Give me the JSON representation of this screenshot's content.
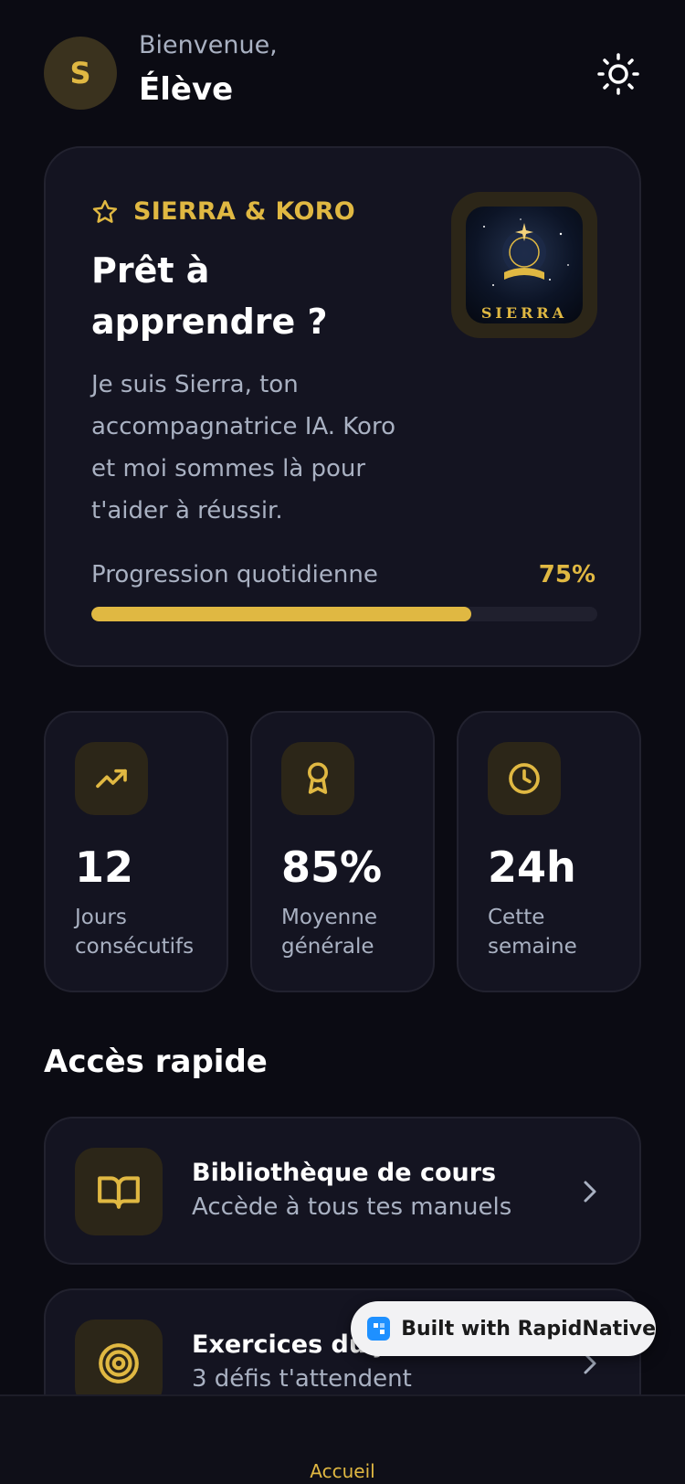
{
  "header": {
    "avatar_initial": "S",
    "greeting": "Bienvenue,",
    "user_name": "Élève",
    "theme_icon": "sun-icon"
  },
  "hero": {
    "brand": "SIERRA & KORO",
    "title": "Prêt à apprendre ?",
    "description": "Je suis Sierra, ton accompagnatrice IA. Koro et moi sommes là pour t'aider à réussir.",
    "logo_text": "SIERRA",
    "progress_label": "Progression quotidienne",
    "progress_text": "75%",
    "progress_value": 0.75
  },
  "stats": [
    {
      "icon": "trending-up-icon",
      "value": "12",
      "label": "Jours consécutifs"
    },
    {
      "icon": "award-icon",
      "value": "85%",
      "label": "Moyenne générale"
    },
    {
      "icon": "clock-icon",
      "value": "24h",
      "label": "Cette semaine"
    }
  ],
  "quick_access": {
    "title": "Accès rapide",
    "items": [
      {
        "icon": "book-open-icon",
        "title": "Bibliothèque de cours",
        "subtitle": "Accède à tous tes manuels"
      },
      {
        "icon": "target-icon",
        "title": "Exercices du jour",
        "subtitle": "3 défis t'attendent"
      }
    ]
  },
  "badge": {
    "text": "Built with RapidNative"
  },
  "bottom_nav": {
    "active_tab": "Accueil"
  },
  "colors": {
    "accent": "#e0b842",
    "background": "#0b0b13",
    "card": "#141421",
    "muted_text": "#a9b1c2"
  }
}
